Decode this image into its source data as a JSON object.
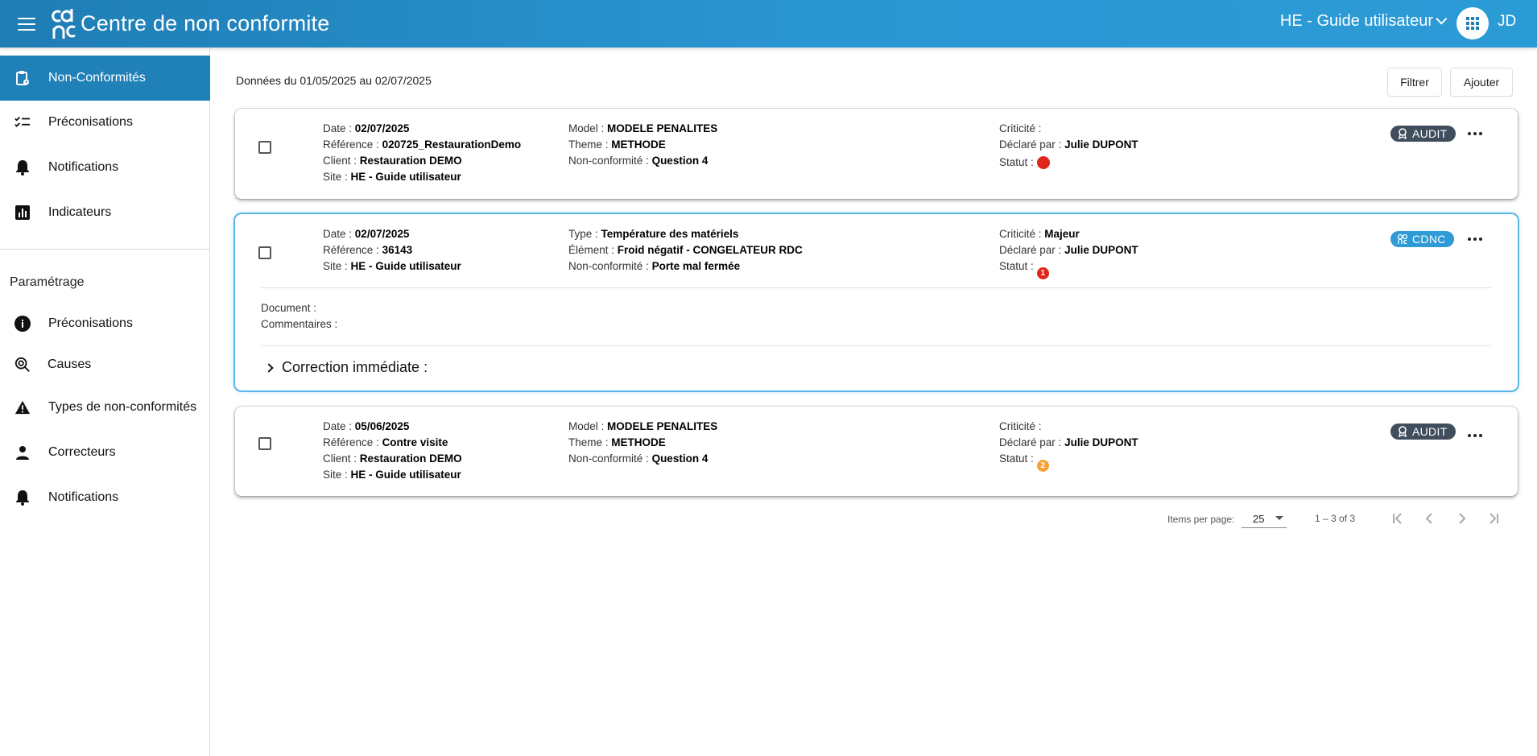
{
  "header": {
    "app_title": "Centre de non conformite",
    "site_name": "HE - Guide utilisateur",
    "avatar_initials": "JD",
    "menu_icon": "hamburger-menu-icon",
    "apps_icon": "apps-grid-icon",
    "color_gradient_start": "#1f7db4",
    "color_gradient_end": "#2b9bd6"
  },
  "sidebar": {
    "main_items": [
      {
        "label": "Non-Conformités",
        "icon": "clipboard-icon",
        "active": true
      },
      {
        "label": "Préconisations",
        "icon": "checklist-icon",
        "active": false
      },
      {
        "label": "Notifications",
        "icon": "bell-icon",
        "active": false
      },
      {
        "label": "Indicateurs",
        "icon": "bar-chart-icon",
        "active": false
      }
    ],
    "settings_title": "Paramétrage",
    "settings_items": [
      {
        "label": "Préconisations",
        "icon": "info-icon"
      },
      {
        "label": "Causes",
        "icon": "search-target-icon"
      },
      {
        "label": "Types de non-conformités",
        "icon": "warning-icon"
      },
      {
        "label": "Correcteurs",
        "icon": "person-icon"
      },
      {
        "label": "Notifications",
        "icon": "bell-icon"
      }
    ],
    "active_color": "#2080b8"
  },
  "main": {
    "date_range": "Données du 01/05/2025 au 02/07/2025",
    "filter_label": "Filtrer",
    "add_label": "Ajouter"
  },
  "cards": [
    {
      "date_label": "Date :",
      "date": "02/07/2025",
      "ref_label": "Référence :",
      "ref": "020725_RestaurationDemo",
      "client_label": "Client :",
      "client": "Restauration DEMO",
      "site_label": "Site :",
      "site": "HE - Guide utilisateur",
      "mid1_label": "Model :",
      "mid1": "MODELE PENALITES",
      "mid2_label": "Theme :",
      "mid2": "METHODE",
      "mid3_label": "Non-conformité :",
      "mid3": "Question 4",
      "crit_label": "Criticité :",
      "crit": "",
      "declared_label": "Déclaré par :",
      "declared": "Julie DUPONT",
      "status_label": "Statut :",
      "status_number": "",
      "status_color": "#e0251b",
      "badge": "AUDIT",
      "badge_color": "#3f4d5d"
    },
    {
      "date_label": "Date :",
      "date": "02/07/2025",
      "ref_label": "Référence :",
      "ref": "36143",
      "site_label": "Site :",
      "site": "HE - Guide utilisateur",
      "mid1_label": "Type :",
      "mid1": "Température des matériels",
      "mid2_label": "Élément :",
      "mid2": "Froid négatif - CONGELATEUR RDC",
      "mid3_label": "Non-conformité :",
      "mid3": "Porte mal fermée",
      "crit_label": "Criticité :",
      "crit": "Majeur",
      "declared_label": "Déclaré par :",
      "declared": "Julie DUPONT",
      "status_label": "Statut :",
      "status_number": "1",
      "status_color": "#e0251b",
      "badge": "CDNC",
      "badge_color": "#2e9bd6",
      "document_label": "Document :",
      "comments_label": "Commentaires :",
      "correction_label": "Correction immédiate :"
    },
    {
      "date_label": "Date :",
      "date": "05/06/2025",
      "ref_label": "Référence :",
      "ref": "Contre visite",
      "client_label": "Client :",
      "client": "Restauration DEMO",
      "site_label": "Site :",
      "site": "HE - Guide utilisateur",
      "mid1_label": "Model :",
      "mid1": "MODELE PENALITES",
      "mid2_label": "Theme :",
      "mid2": "METHODE",
      "mid3_label": "Non-conformité :",
      "mid3": "Question 4",
      "crit_label": "Criticité :",
      "crit": "",
      "declared_label": "Déclaré par :",
      "declared": "Julie DUPONT",
      "status_label": "Statut :",
      "status_number": "2",
      "status_color": "#f5a23a",
      "badge": "AUDIT",
      "badge_color": "#3f4d5d"
    }
  ],
  "pagination": {
    "items_per_page_label": "Items per page:",
    "page_size": "25",
    "range": "1 – 3 of 3"
  }
}
